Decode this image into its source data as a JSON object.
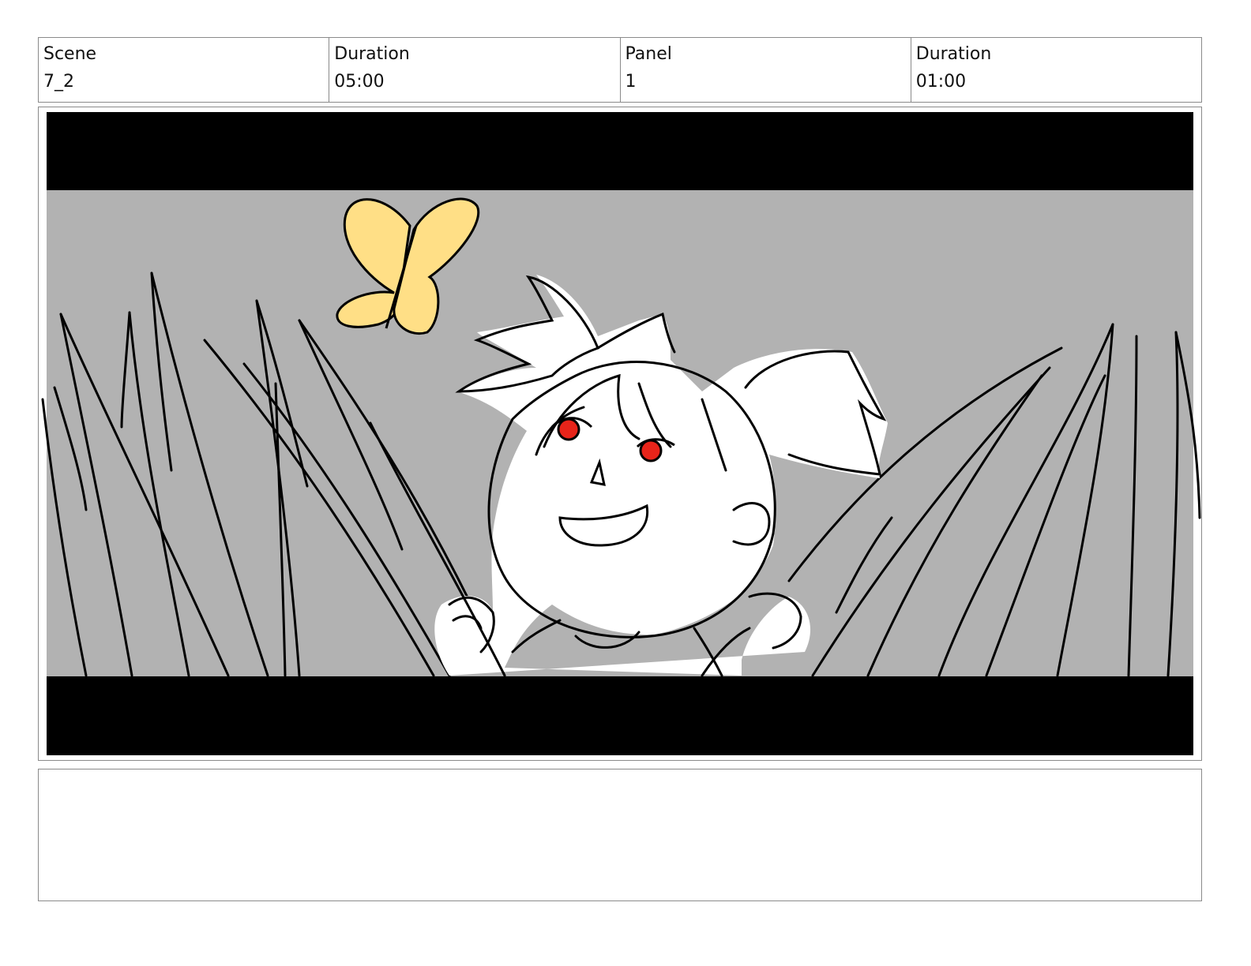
{
  "header": {
    "scene_label": "Scene",
    "scene_value": "7_2",
    "scene_duration_label": "Duration",
    "scene_duration_value": "05:00",
    "panel_label": "Panel",
    "panel_value": "1",
    "panel_duration_label": "Duration",
    "panel_duration_value": "01:00"
  },
  "colors": {
    "sky_gray": "#b2b2b2",
    "letterbox": "#000000",
    "butterfly": "#ffdf86",
    "eyes": "#e8241a"
  },
  "notes": {
    "text": ""
  }
}
